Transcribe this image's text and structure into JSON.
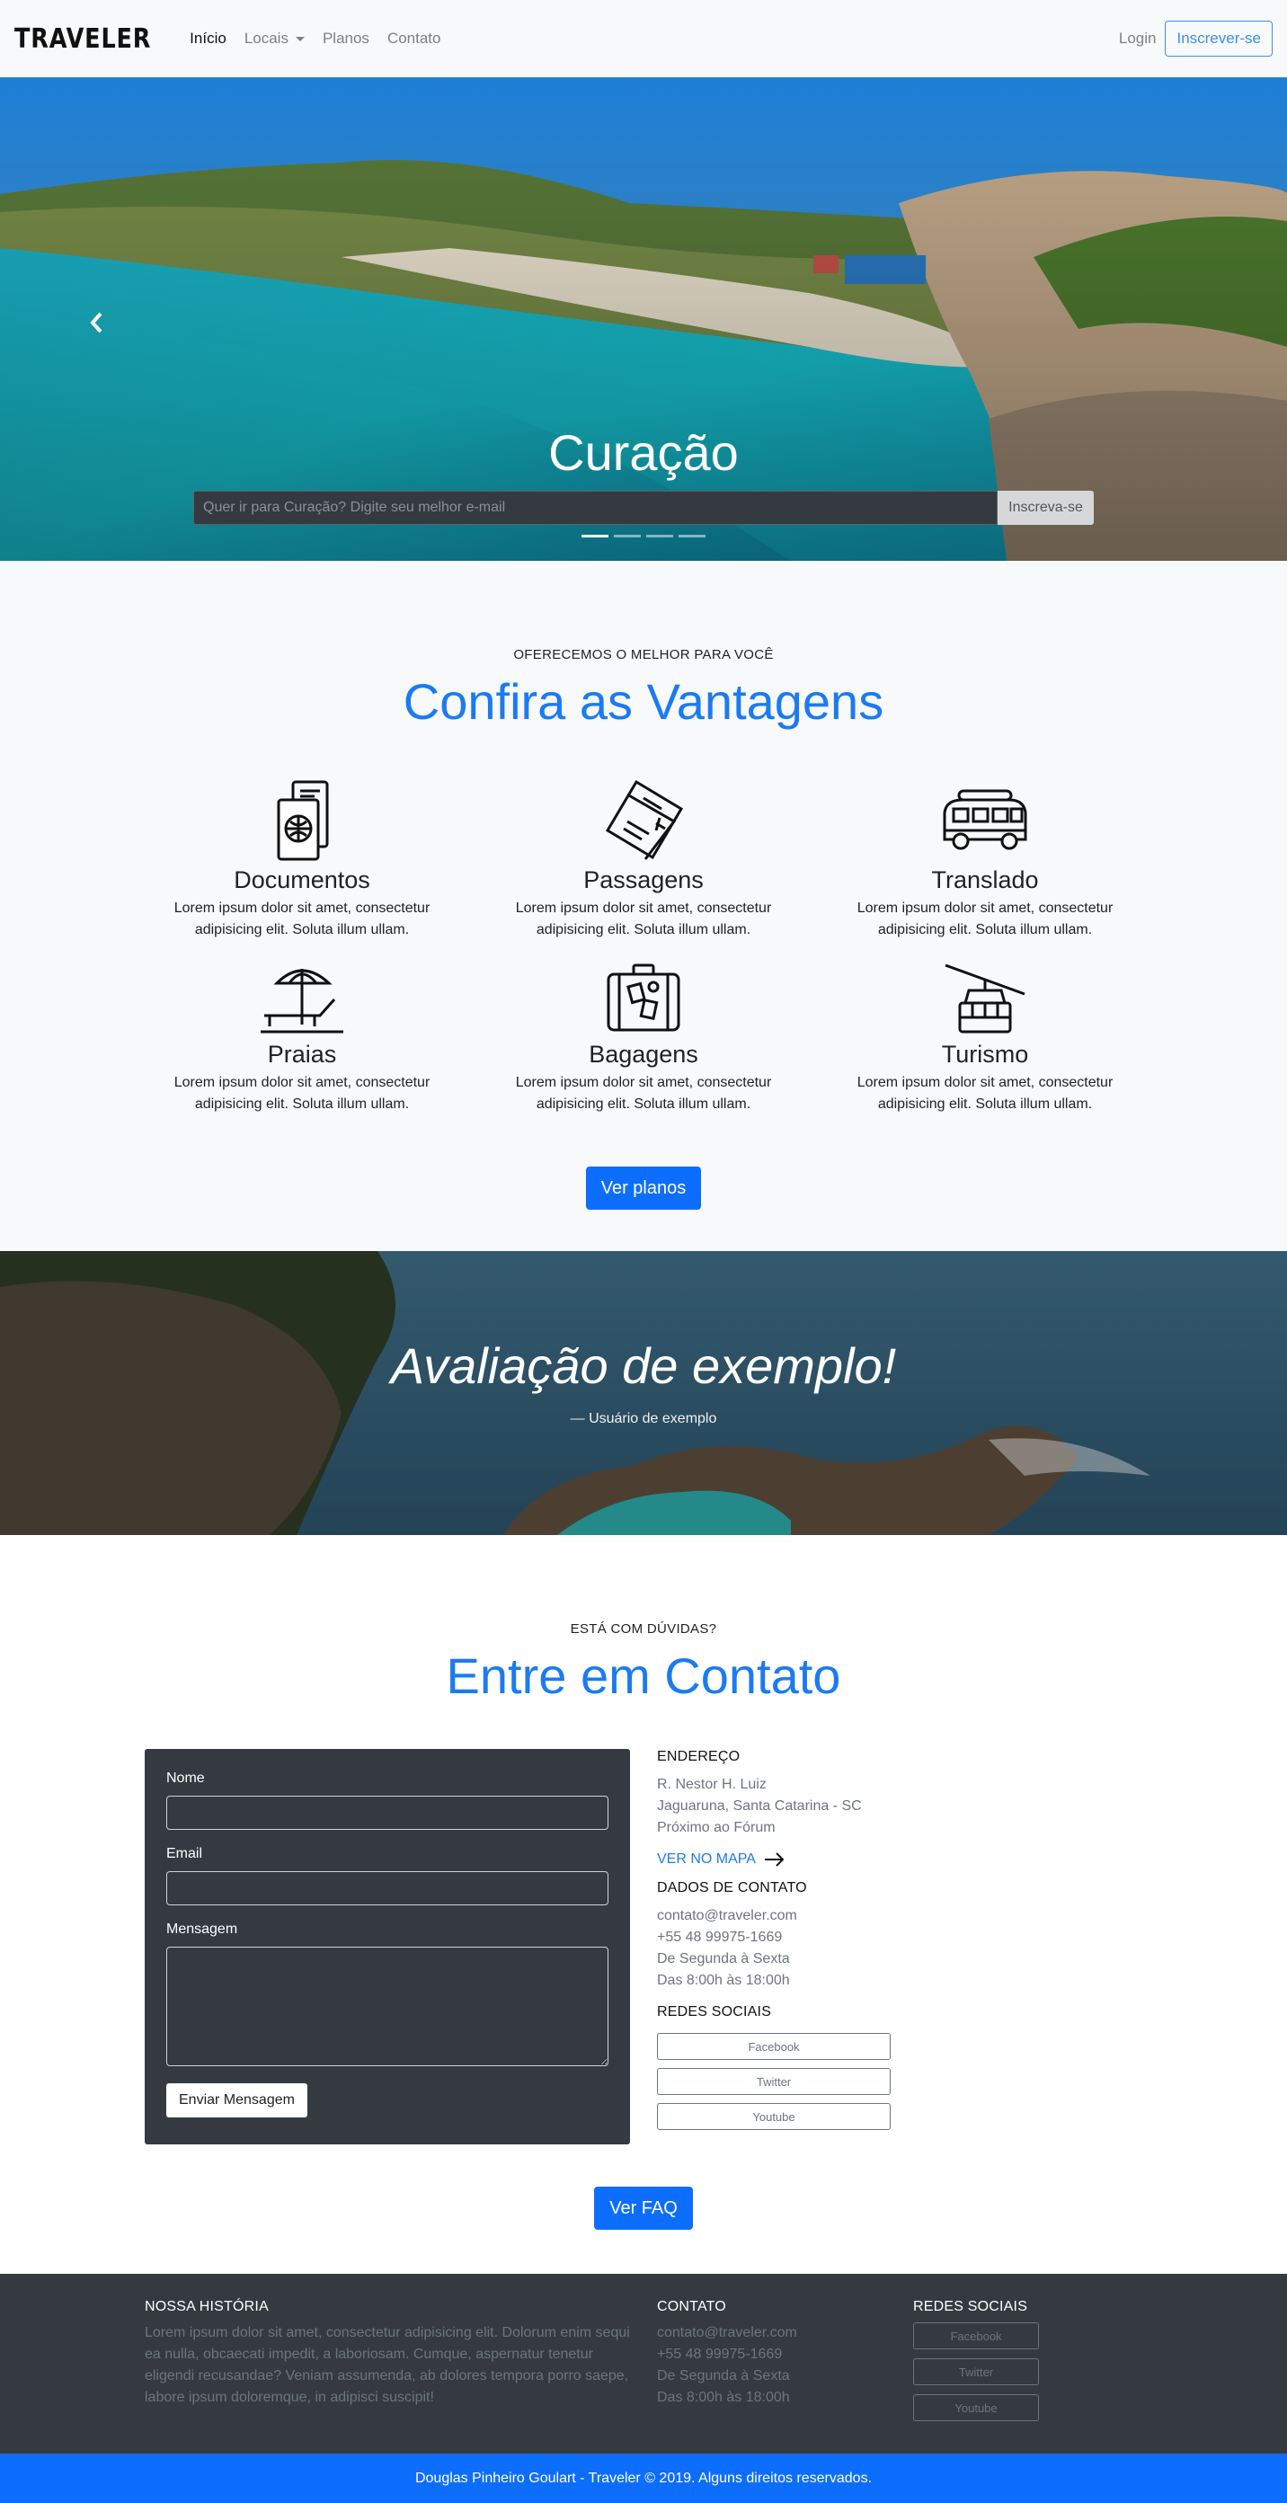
{
  "navbar": {
    "brand": "TRAVELER",
    "links": [
      {
        "label": "Início"
      },
      {
        "label": "Locais"
      },
      {
        "label": "Planos"
      },
      {
        "label": "Contato"
      }
    ],
    "login": "Login",
    "signup": "Inscrever-se"
  },
  "hero": {
    "title": "Curação",
    "input_placeholder": "Quer ir para Curação? Digite seu melhor e-mail",
    "button": "Inscreva-se",
    "slides": 4,
    "active_slide": 1
  },
  "advantages": {
    "eyebrow": "OFERECEMOS O MELHOR PARA VOCÊ",
    "title": "Confira as Vantagens",
    "items": [
      {
        "icon": "passport-icon",
        "title": "Documentos",
        "text": "Lorem ipsum dolor sit amet, consectetur adipisicing elit. Soluta illum ullam."
      },
      {
        "icon": "ticket-icon",
        "title": "Passagens",
        "text": "Lorem ipsum dolor sit amet, consectetur adipisicing elit. Soluta illum ullam."
      },
      {
        "icon": "van-icon",
        "title": "Translado",
        "text": "Lorem ipsum dolor sit amet, consectetur adipisicing elit. Soluta illum ullam."
      },
      {
        "icon": "beach-chair-icon",
        "title": "Praias",
        "text": "Lorem ipsum dolor sit amet, consectetur adipisicing elit. Soluta illum ullam."
      },
      {
        "icon": "suitcase-icon",
        "title": "Bagagens",
        "text": "Lorem ipsum dolor sit amet, consectetur adipisicing elit. Soluta illum ullam."
      },
      {
        "icon": "cable-car-icon",
        "title": "Turismo",
        "text": "Lorem ipsum dolor sit amet, consectetur adipisicing elit. Soluta illum ullam."
      }
    ],
    "button": "Ver planos"
  },
  "testimonial": {
    "quote": "Avaliação de exemplo!",
    "author": "— Usuário de exemplo"
  },
  "contact": {
    "eyebrow": "ESTÁ COM DÚVIDAS?",
    "title": "Entre em Contato",
    "form": {
      "name_label": "Nome",
      "email_label": "Email",
      "message_label": "Mensagem",
      "submit": "Enviar Mensagem"
    },
    "address": {
      "heading": "ENDEREÇO",
      "lines": [
        "R. Nestor H. Luiz",
        "Jaguaruna, Santa Catarina - SC",
        "Próximo ao Fórum"
      ],
      "map_link": "VER NO MAPA"
    },
    "details": {
      "heading": "DADOS DE CONTATO",
      "lines": [
        "contato@traveler.com",
        "+55 48 99975-1669",
        "De Segunda à Sexta",
        "Das 8:00h às 18:00h"
      ]
    },
    "social": {
      "heading": "REDES SOCIAIS",
      "links": [
        "Facebook",
        "Twitter",
        "Youtube"
      ]
    },
    "faq_button": "Ver FAQ"
  },
  "footer": {
    "history": {
      "heading": "NOSSA HISTÓRIA",
      "text": "Lorem ipsum dolor sit amet, consectetur adipisicing elit. Dolorum enim sequi ea nulla, obcaecati impedit, a laboriosam. Cumque, aspernatur tenetur eligendi recusandae? Veniam assumenda, ab dolores tempora porro saepe, labore ipsum doloremque, in adipisci suscipit!"
    },
    "contact": {
      "heading": "CONTATO",
      "lines": [
        "contato@traveler.com",
        "+55 48 99975-1669",
        "De Segunda à Sexta",
        "Das 8:00h às 18:00h"
      ]
    },
    "social": {
      "heading": "REDES SOCIAIS",
      "links": [
        "Facebook",
        "Twitter",
        "Youtube"
      ]
    },
    "copyright": "Douglas Pinheiro Goulart - Traveler © 2019. Alguns direitos reservados."
  },
  "colors": {
    "primary": "#0d6efd",
    "heading_blue": "#1a7bf2",
    "dark": "#343a40",
    "light": "#f8f9fa"
  }
}
